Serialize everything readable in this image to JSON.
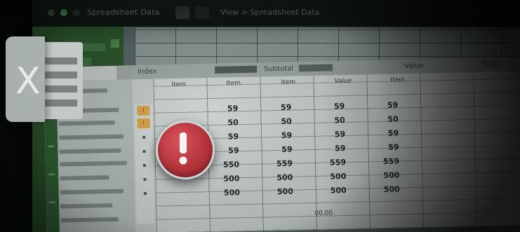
{
  "window": {
    "title": "Spreadsheet Data",
    "path": "View > Spreadsheet Data"
  },
  "sheet": {
    "header_labels": [
      "Index",
      "Subtotal",
      "Value",
      "Total"
    ],
    "column_headers": [
      "Item",
      "Item",
      "Item",
      "Value",
      "Item"
    ],
    "row_values": [
      [
        "59",
        "59",
        "59",
        "59"
      ],
      [
        "50",
        "50",
        "50",
        "50"
      ],
      [
        "59",
        "59",
        "59",
        "59"
      ],
      [
        "59",
        "59",
        "59",
        "59"
      ],
      [
        "550",
        "559",
        "559",
        "559"
      ],
      [
        "500",
        "500",
        "500",
        "500"
      ],
      [
        "500",
        "500",
        "500",
        "500"
      ]
    ],
    "footer_value": "00.00"
  },
  "colors": {
    "excel_green": "#2f5c33",
    "error_red": "#b5343c"
  },
  "icons": {
    "logo": "excel-logo-icon",
    "error": "exclamation-error-icon"
  }
}
